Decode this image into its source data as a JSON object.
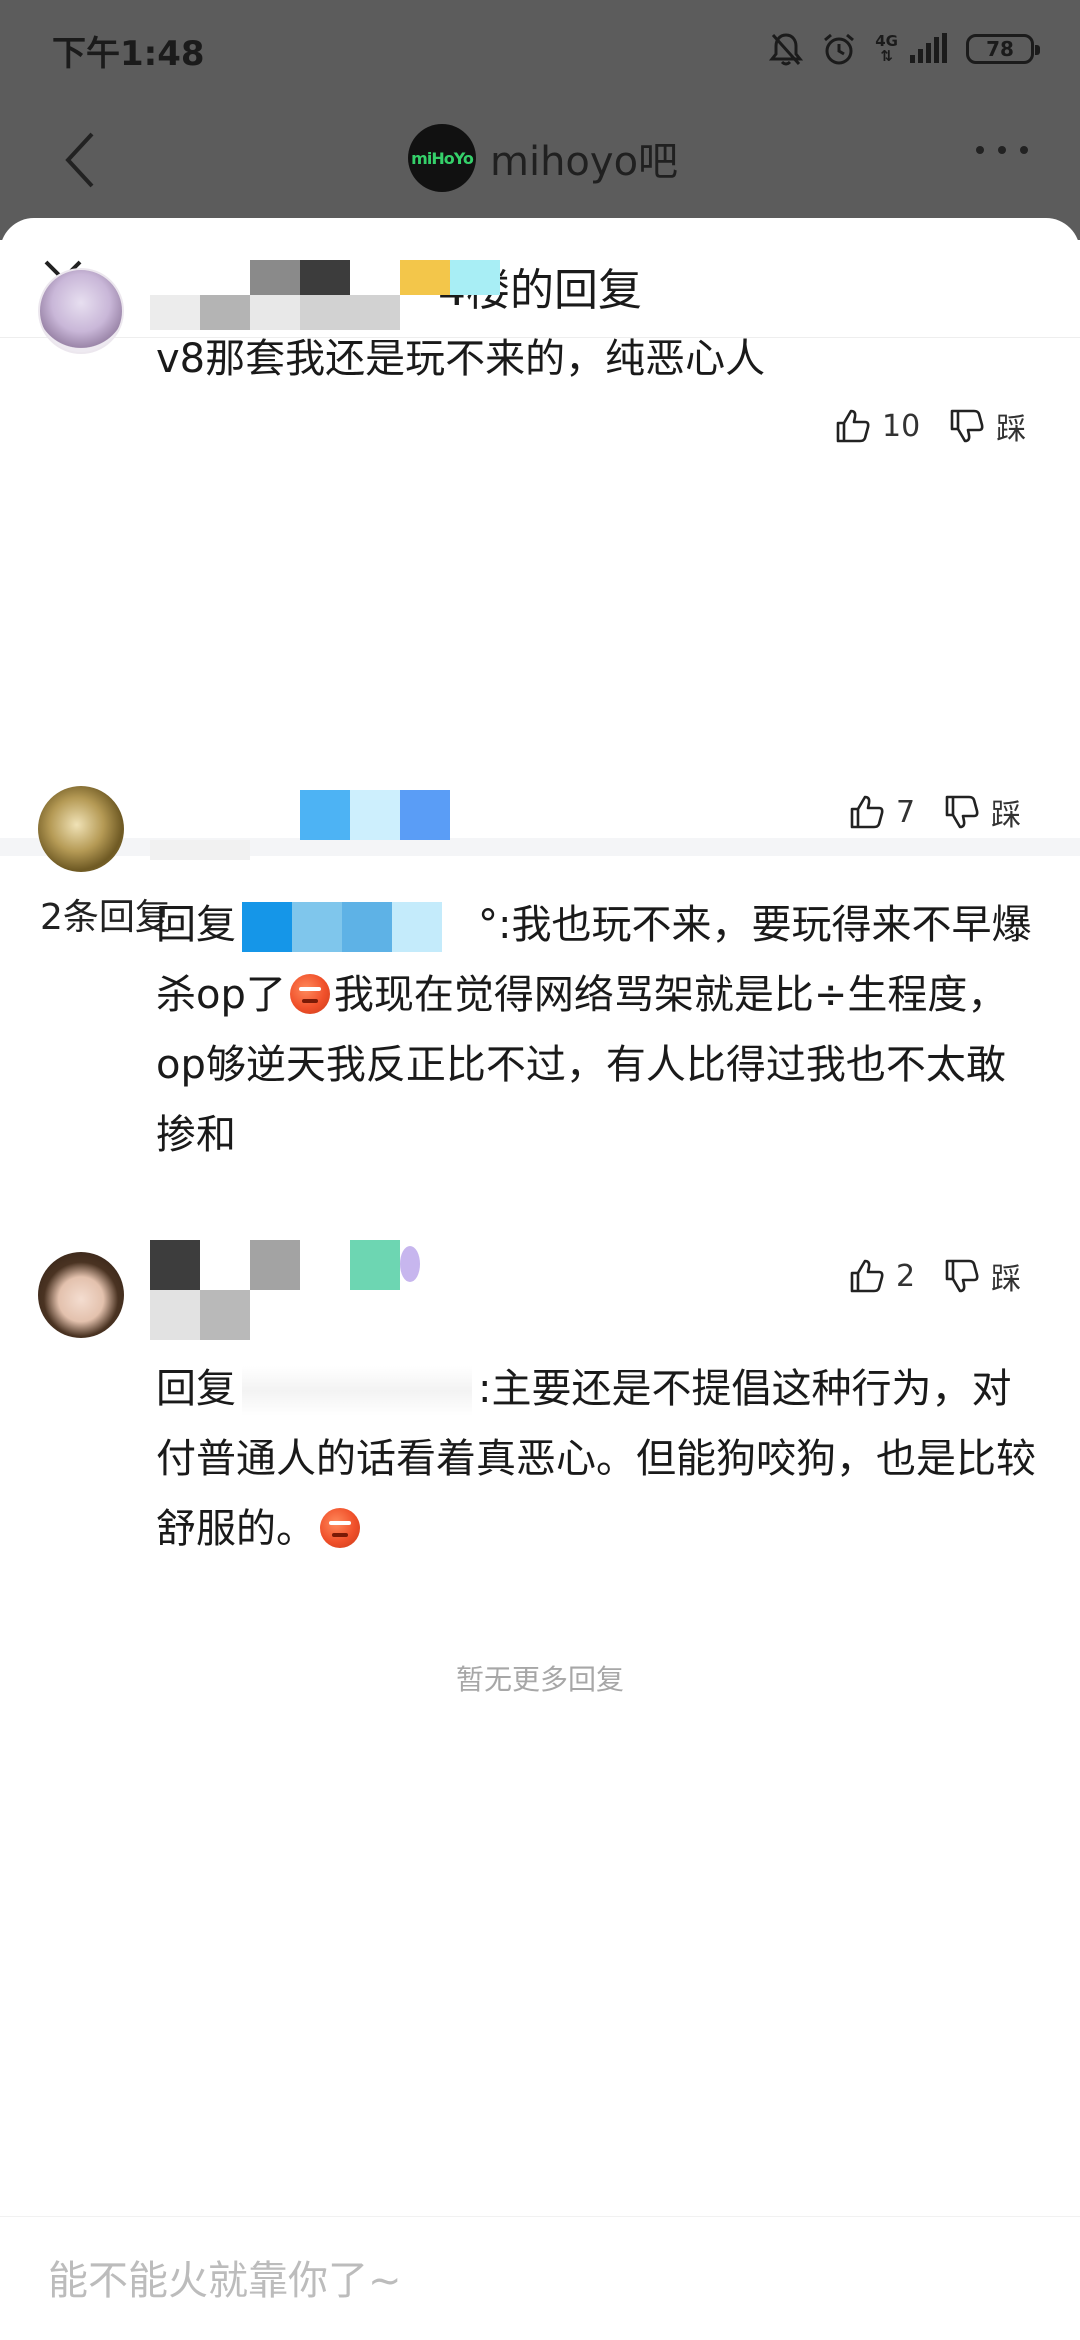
{
  "status_bar": {
    "time": "下午1:48",
    "network": "4G",
    "battery": "78"
  },
  "background_nav": {
    "forum_logo": "miHoYo",
    "forum_name": "mihoyo吧"
  },
  "sheet": {
    "title": "4楼的回复"
  },
  "main_comment": {
    "likes": "10",
    "dislike_label": "踩",
    "text": "v8那套我还是玩不来的，纯恶心人"
  },
  "replies_count": "2条回复",
  "replies": [
    {
      "likes": "7",
      "dislike_label": "踩",
      "prefix": "回复",
      "text_after_mention": "°:我也玩不来，要玩得来不早爆杀op了",
      "text_tail": "我现在觉得网络骂架就是比÷生程度，op够逆天我反正比不过，有人比得过我也不太敢掺和"
    },
    {
      "likes": "2",
      "dislike_label": "踩",
      "prefix": "回复",
      "text_after_mention": ":主要还是不提倡这种行为，对付普通人的话看着真恶心。但能狗咬狗，也是比较舒服的。"
    }
  ],
  "no_more": "暂无更多回复",
  "input": {
    "placeholder": "能不能火就靠你了~"
  },
  "icons": {
    "back": "chevron-left-icon",
    "more": "more-dots-icon",
    "close": "close-icon",
    "like": "thumb-up-icon",
    "dislike": "thumb-down-icon",
    "emoji": "angry-face-emoji"
  }
}
